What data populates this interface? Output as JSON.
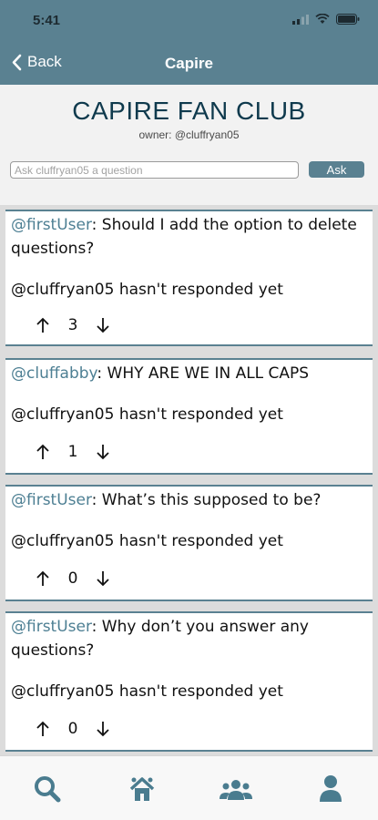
{
  "status_bar": {
    "time": "5:41"
  },
  "nav": {
    "back_label": "Back",
    "title": "Capire"
  },
  "club": {
    "title": "CAPIRE FAN CLUB",
    "owner": "owner: @cluffryan05",
    "ask_placeholder": "Ask cluffryan05 a question",
    "ask_button": "Ask"
  },
  "questions": [
    {
      "user": "@firstUser",
      "text": ": Should I add the option to delete questions?",
      "response": "@cluffryan05 hasn't responded yet",
      "votes": "3"
    },
    {
      "user": "@cluffabby",
      "text": ": WHY ARE WE IN ALL CAPS",
      "response": "@cluffryan05 hasn't responded yet",
      "votes": "1"
    },
    {
      "user": "@firstUser",
      "text": ": What’s this supposed to be?",
      "response": "@cluffryan05 hasn't responded yet",
      "votes": "0"
    },
    {
      "user": "@firstUser",
      "text": ": Why don’t you answer any questions?",
      "response": "@cluffryan05 hasn't responded yet",
      "votes": "0"
    }
  ],
  "tabbar": {
    "icons": [
      "search-icon",
      "home-icon",
      "group-icon",
      "profile-icon"
    ],
    "active_color": "#4a7c8f"
  },
  "colors": {
    "accent": "#5a8191",
    "title": "#0f3a4d",
    "username": "#4d7f93"
  }
}
